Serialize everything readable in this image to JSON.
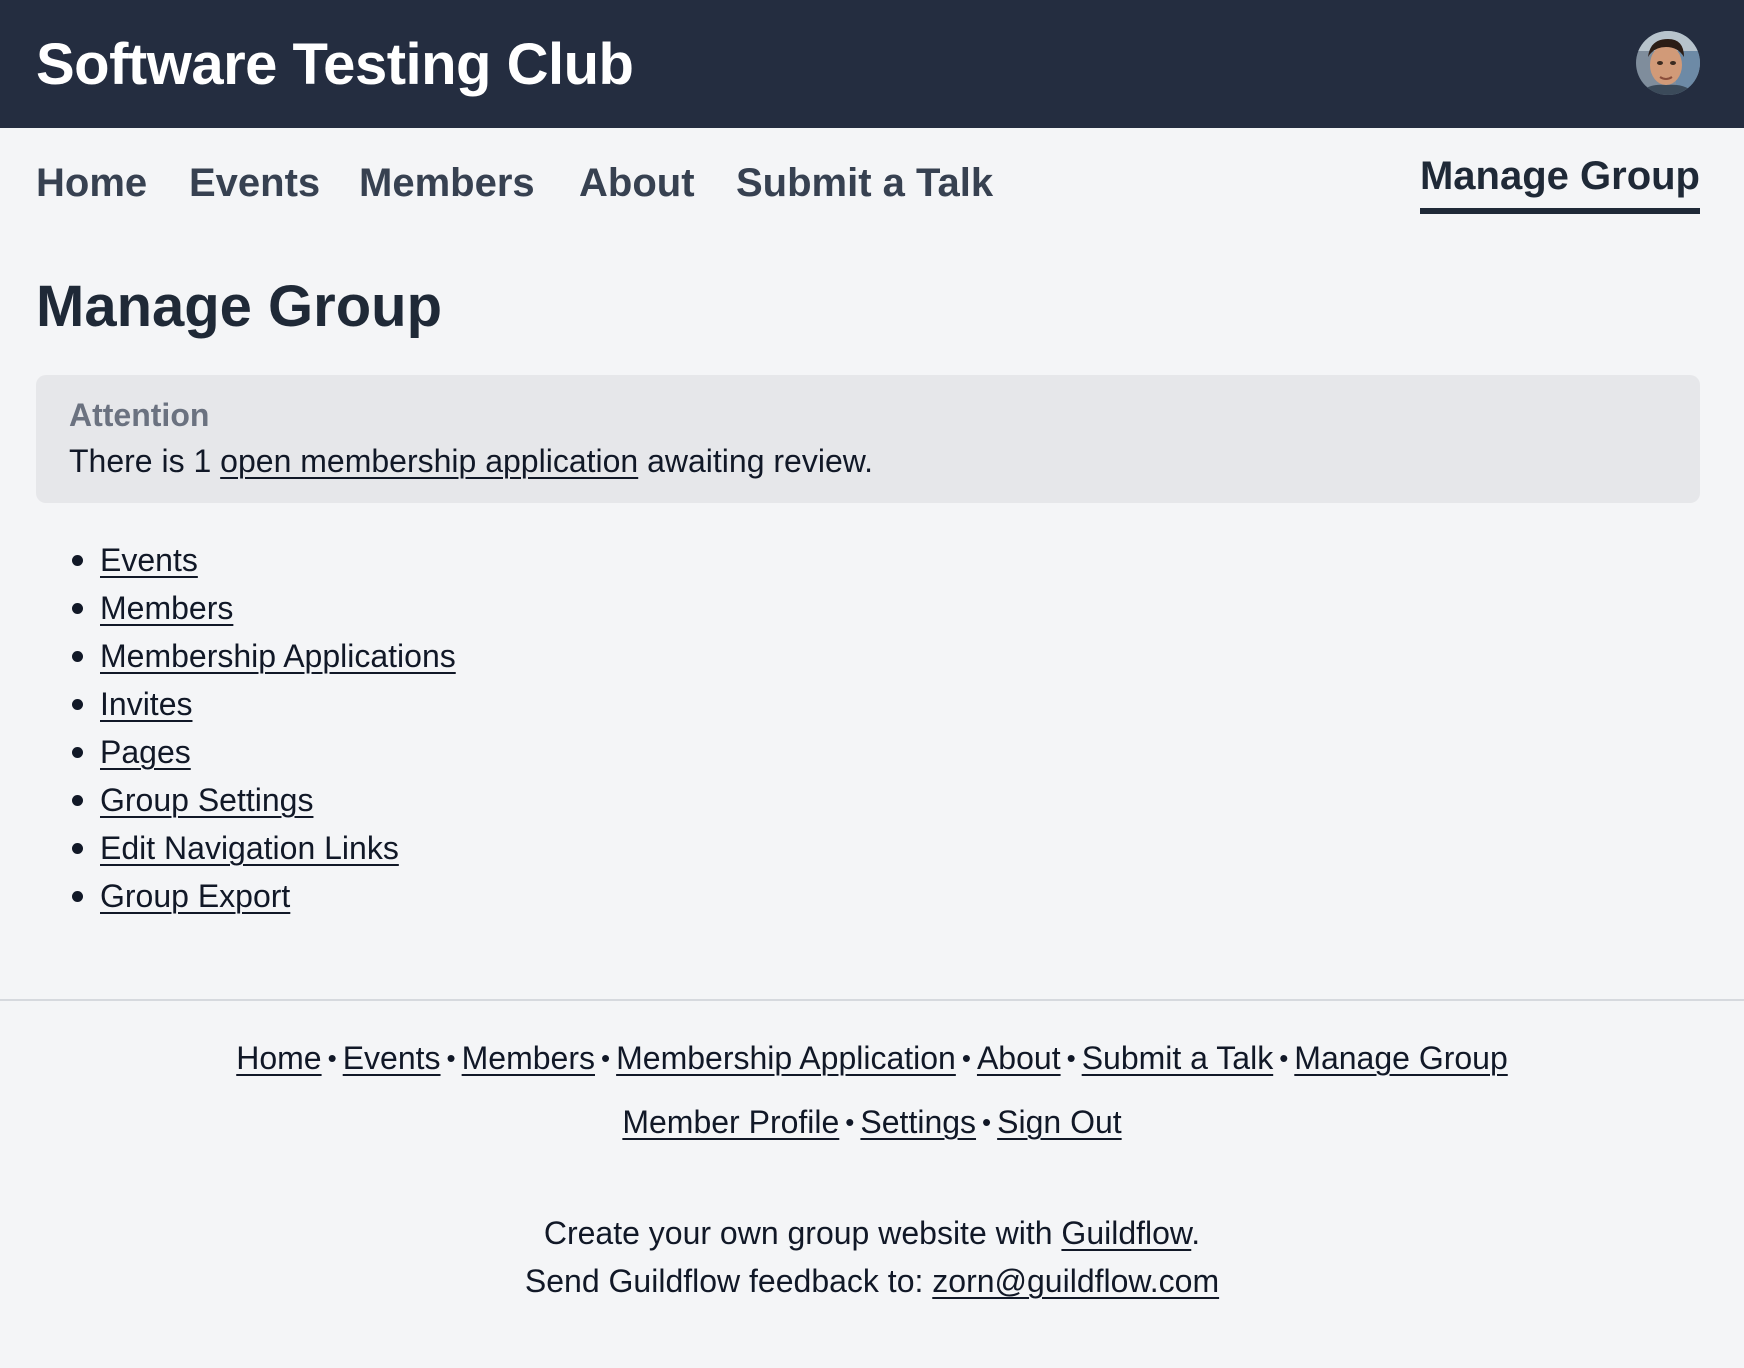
{
  "header": {
    "site_title": "Software Testing Club",
    "avatar_icon": "user-avatar-icon"
  },
  "nav": {
    "items": [
      {
        "label": "Home"
      },
      {
        "label": "Events"
      },
      {
        "label": "Members"
      },
      {
        "label": "About"
      },
      {
        "label": "Submit a Talk"
      }
    ],
    "active_label": "Manage Group"
  },
  "main": {
    "title": "Manage Group",
    "alert": {
      "title": "Attention",
      "prefix": "There is 1 ",
      "link_text": "open membership application",
      "suffix": " awaiting review."
    },
    "links": [
      "Events",
      "Members",
      "Membership Applications",
      "Invites",
      "Pages",
      "Group Settings",
      "Edit Navigation Links",
      "Group Export"
    ]
  },
  "footer": {
    "row1": [
      "Home",
      "Events",
      "Members",
      "Membership Application",
      "About",
      "Submit a Talk",
      "Manage Group"
    ],
    "row2": [
      "Member Profile",
      "Settings",
      "Sign Out"
    ],
    "separator": "•",
    "promo_prefix": "Create your own group website with ",
    "promo_link": "Guildflow",
    "promo_suffix": ".",
    "feedback_prefix": "Send Guildflow feedback to: ",
    "feedback_email": "zorn@guildflow.com"
  },
  "colors": {
    "header_bg": "#242d40",
    "page_bg": "#f4f5f7",
    "alert_bg": "#e6e7ea",
    "text": "#111827",
    "nav_text": "#374151",
    "muted": "#6b7280"
  }
}
